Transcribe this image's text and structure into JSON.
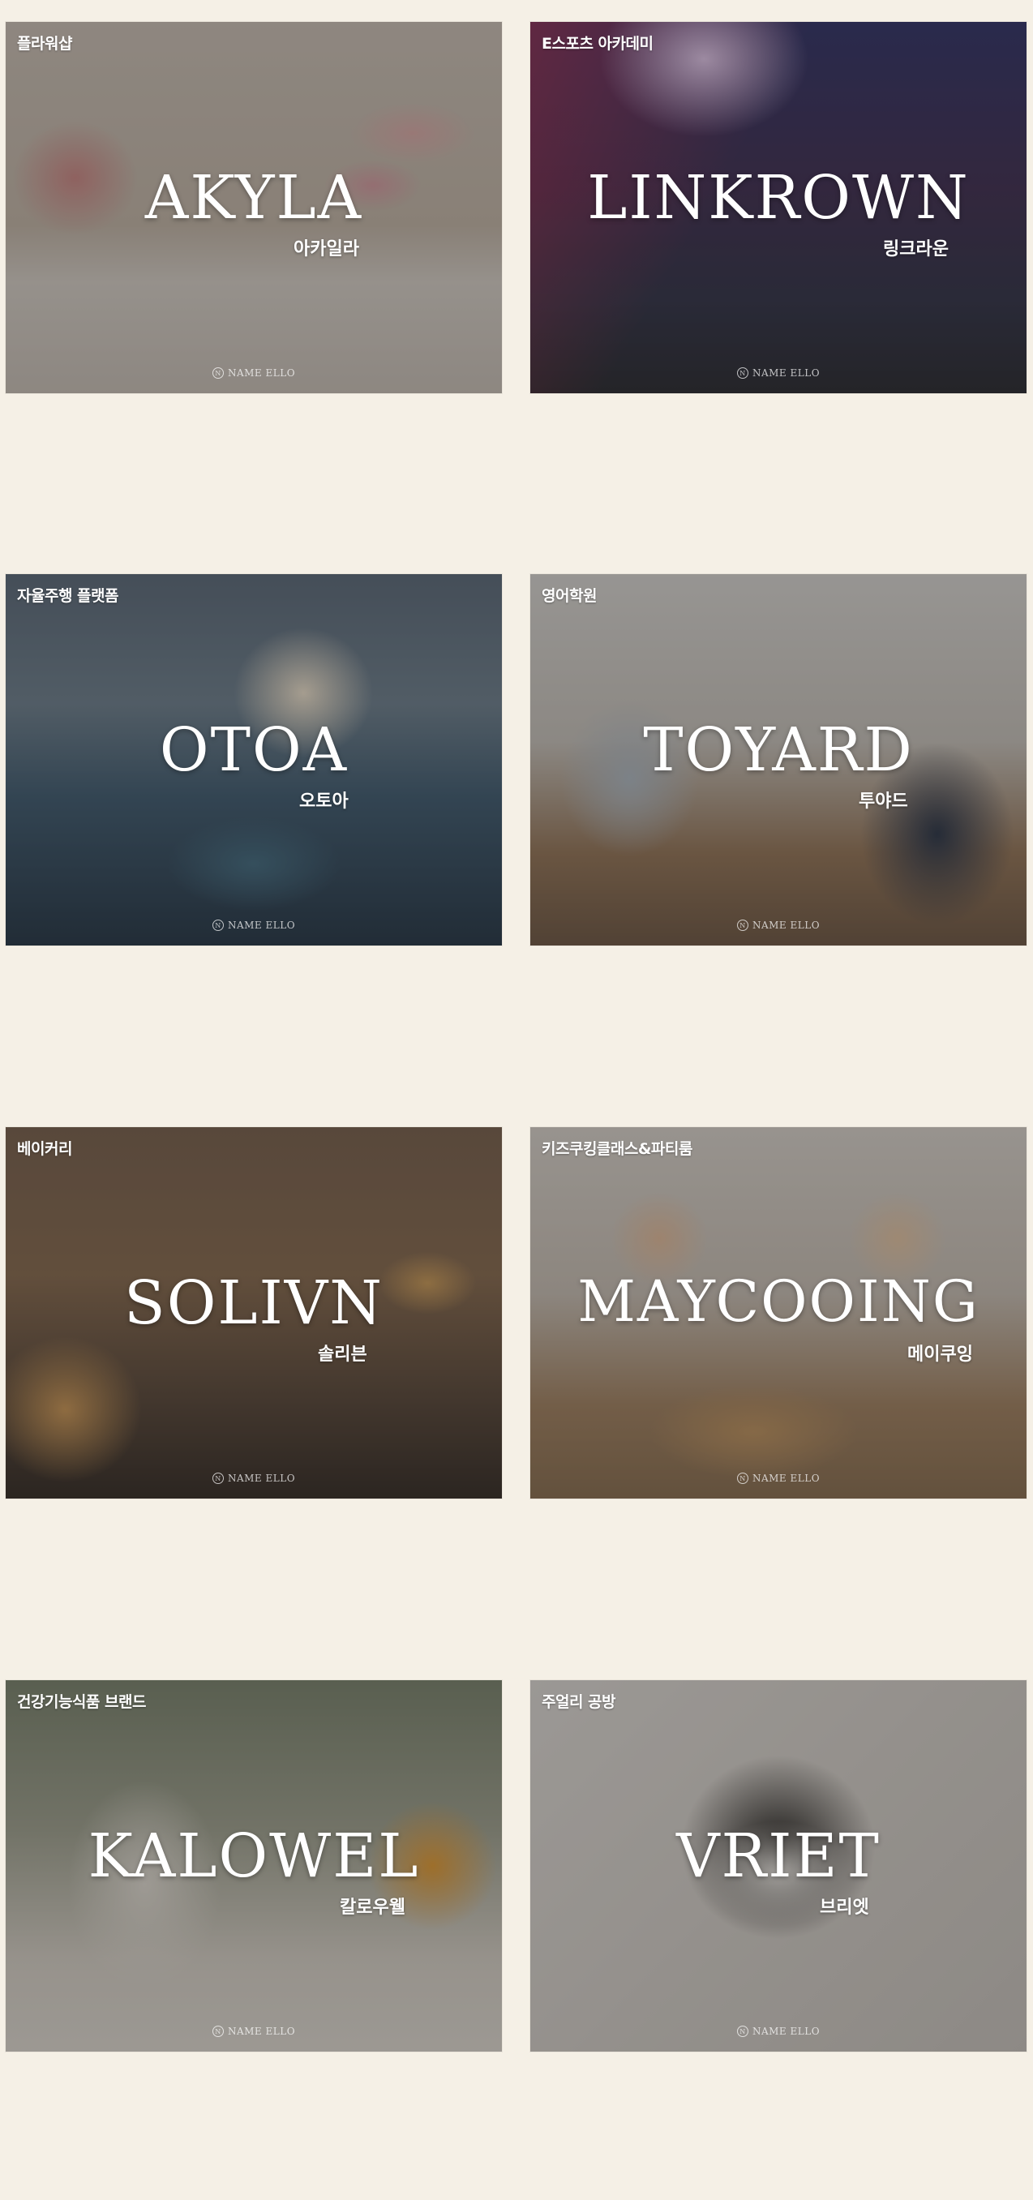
{
  "cards": [
    {
      "category": "플라워샵",
      "brand": "AKYLA",
      "korean": "아카일라"
    },
    {
      "category": "E스포츠 아카데미",
      "brand": "LINKROWN",
      "korean": "링크라운"
    },
    {
      "category": "자율주행 플랫폼",
      "brand": "OTOA",
      "korean": "오토아"
    },
    {
      "category": "영어학원",
      "brand": "TOYARD",
      "korean": "투야드"
    },
    {
      "category": "베이커리",
      "brand": "SOLIVN",
      "korean": "솔리븐"
    },
    {
      "category": "키즈쿠킹클래스&파티룸",
      "brand": "MAYCOOING",
      "korean": "메이쿠잉"
    },
    {
      "category": "건강기능식품 브랜드",
      "brand": "KALOWEL",
      "korean": "칼로우웰"
    },
    {
      "category": "주얼리 공방",
      "brand": "VRIET",
      "korean": "브리엣"
    }
  ],
  "watermark": {
    "text": "NAME ELLO",
    "logo_letter": "N"
  },
  "colors": {
    "page_background": "#f5f0e6"
  }
}
